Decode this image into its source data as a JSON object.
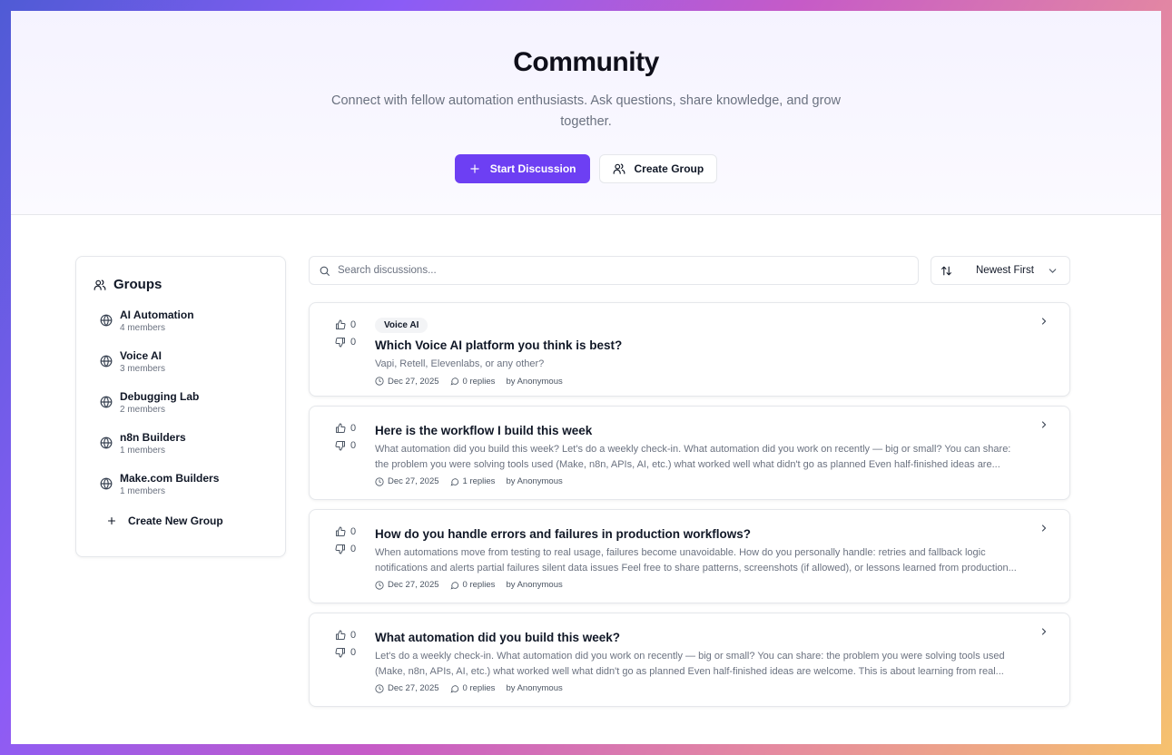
{
  "hero": {
    "title": "Community",
    "subtitle": "Connect with fellow automation enthusiasts. Ask questions, share knowledge, and grow together.",
    "start_discussion_label": "Start Discussion",
    "create_group_label": "Create Group"
  },
  "sidebar": {
    "title": "Groups",
    "groups": [
      {
        "name": "AI Automation",
        "members": "4 members"
      },
      {
        "name": "Voice AI",
        "members": "3 members"
      },
      {
        "name": "Debugging Lab",
        "members": "2 members"
      },
      {
        "name": "n8n Builders",
        "members": "1 members"
      },
      {
        "name": "Make.com Builders",
        "members": "1 members"
      }
    ],
    "create_label": "Create New Group"
  },
  "search": {
    "placeholder": "Search discussions...",
    "value": ""
  },
  "sort": {
    "label": "Newest First"
  },
  "posts": [
    {
      "upvotes": "0",
      "downvotes": "0",
      "tag": "Voice AI",
      "title": "Which Voice AI platform you think is best?",
      "excerpt": "Vapi, Retell, Elevenlabs, or any other?",
      "date": "Dec 27, 2025",
      "replies": "0 replies",
      "author": "by Anonymous"
    },
    {
      "upvotes": "0",
      "downvotes": "0",
      "tag": "",
      "title": "Here is the workflow I build this week",
      "excerpt": "What automation did you build this week? Let's do a weekly check-in. What automation did you work on recently — big or small? You can share: the problem you were solving tools used (Make, n8n, APIs, AI, etc.) what worked well what didn't go as planned Even half-finished ideas are...",
      "date": "Dec 27, 2025",
      "replies": "1 replies",
      "author": "by Anonymous"
    },
    {
      "upvotes": "0",
      "downvotes": "0",
      "tag": "",
      "title": "How do you handle errors and failures in production workflows?",
      "excerpt": "When automations move from testing to real usage, failures become unavoidable. How do you personally handle: retries and fallback logic notifications and alerts partial failures silent data issues Feel free to share patterns, screenshots (if allowed), or lessons learned from production...",
      "date": "Dec 27, 2025",
      "replies": "0 replies",
      "author": "by Anonymous"
    },
    {
      "upvotes": "0",
      "downvotes": "0",
      "tag": "",
      "title": "What automation did you build this week?",
      "excerpt": "Let's do a weekly check-in. What automation did you work on recently — big or small? You can share: the problem you were solving tools used (Make, n8n, APIs, AI, etc.) what worked well what didn't go as planned Even half-finished ideas are welcome. This is about learning from real...",
      "date": "Dec 27, 2025",
      "replies": "0 replies",
      "author": "by Anonymous"
    }
  ],
  "colors": {
    "accent": "#6d3ff3",
    "border": "#e5e7eb",
    "muted_text": "#6b7280"
  }
}
